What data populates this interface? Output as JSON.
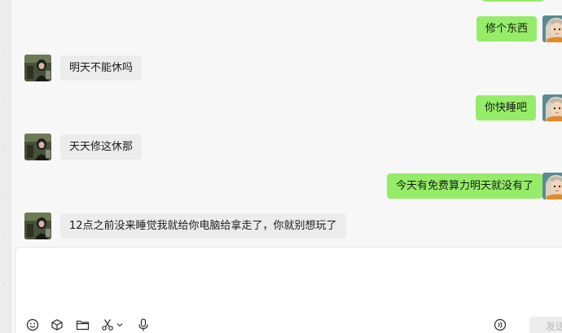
{
  "conversation": {
    "messages": [
      {
        "side": "out",
        "text": "修个东西"
      },
      {
        "side": "in",
        "text": "明天不能休吗"
      },
      {
        "side": "out",
        "text": "你快睡吧"
      },
      {
        "side": "in",
        "text": "天天修这休那"
      },
      {
        "side": "out",
        "text": "今天有免费算力明天就没有了"
      },
      {
        "side": "in",
        "text": "12点之前没来睡觉我就给你电脑给拿走了，你就别想玩了"
      }
    ]
  },
  "input": {
    "value": "",
    "send_label": "发送"
  },
  "toolbar": {
    "icons": [
      "emoji-icon",
      "cube-icon",
      "folder-icon",
      "scissors-icon",
      "chevron-down-icon",
      "microphone-icon",
      "voice-call-icon"
    ]
  },
  "colors": {
    "outgoing_bubble": "#95ec69",
    "incoming_bubble": "#ececec",
    "background": "#f7f7f7"
  }
}
